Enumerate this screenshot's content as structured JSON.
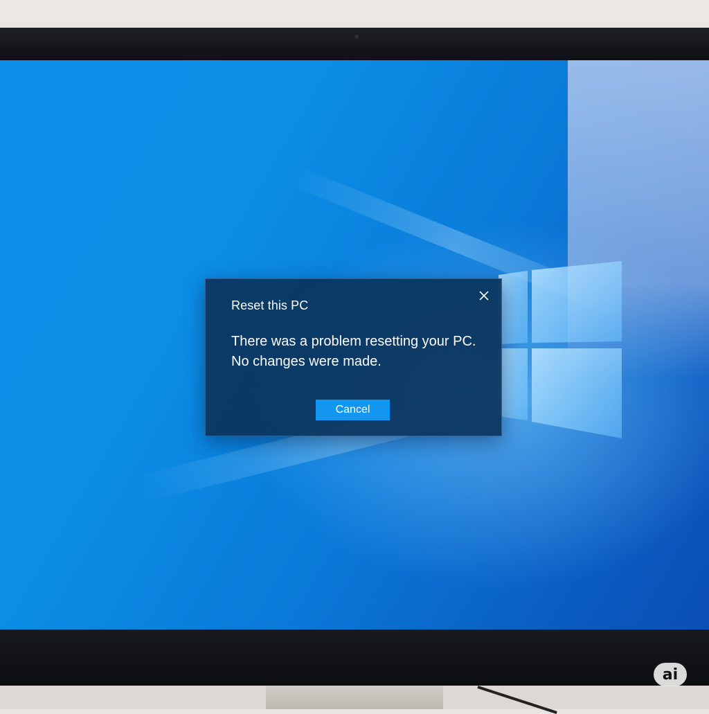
{
  "dialog": {
    "title": "Reset this PC",
    "message_lines": [
      "There was a problem resetting your PC.",
      "No changes were made."
    ],
    "cancel_label": "Cancel",
    "close_icon": "close-icon"
  },
  "watermark": {
    "label": "ai"
  },
  "colors": {
    "desktop_blue": "#0a8ee8",
    "dialog_background": "#0b345c",
    "button_accent": "#1396ef"
  },
  "icons": [
    "close-icon",
    "windows-logo-icon",
    "webcam-icon"
  ]
}
